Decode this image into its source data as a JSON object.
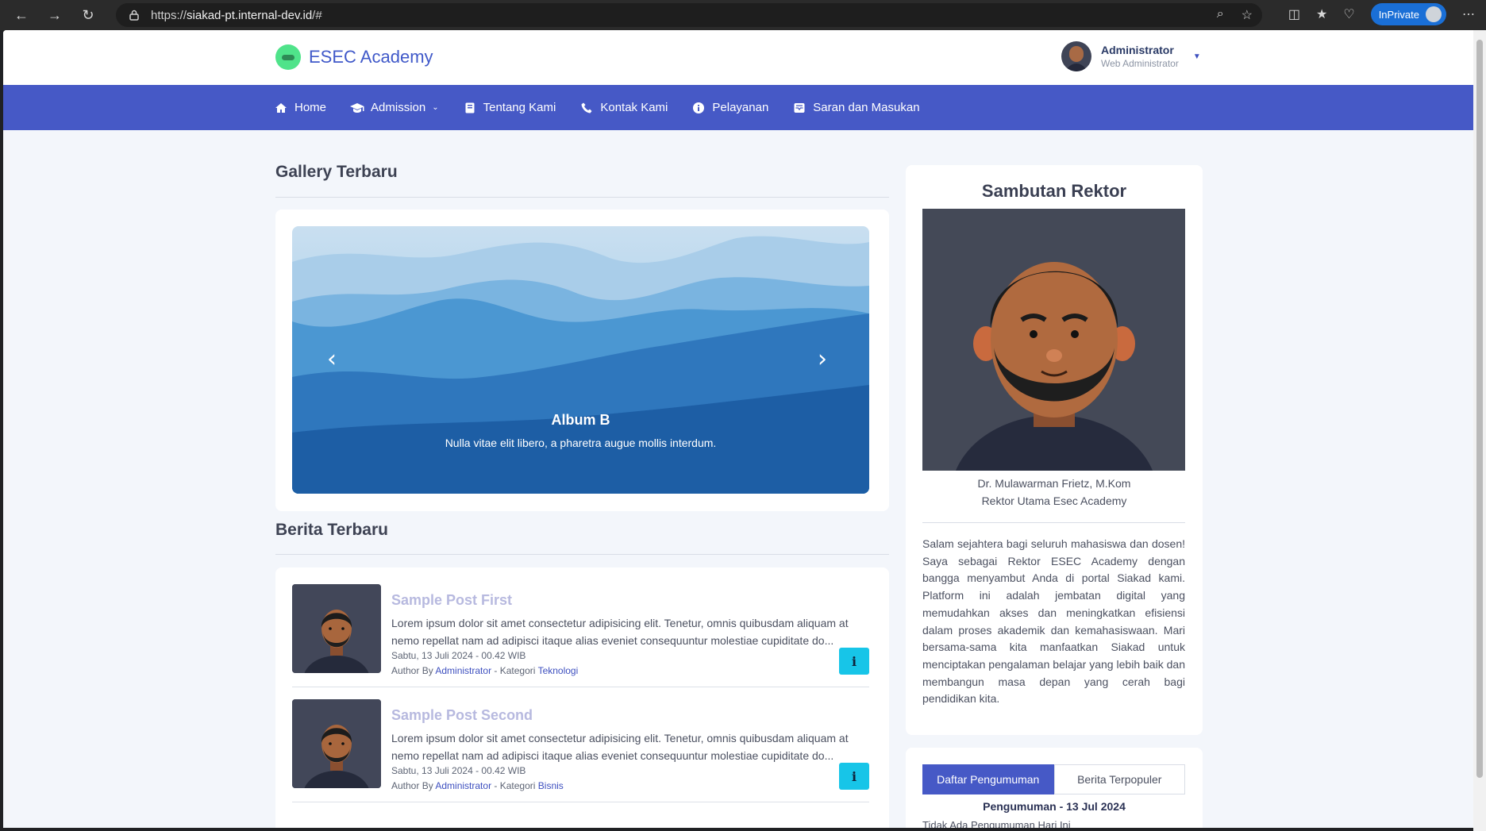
{
  "browser": {
    "url_prefix": "https://",
    "url_host": "siakad-pt.internal-dev.id",
    "url_suffix": "/#",
    "inprivate_label": "InPrivate"
  },
  "header": {
    "brand": "ESEC Academy",
    "user_name": "Administrator",
    "user_role": "Web Administrator"
  },
  "nav": {
    "items": [
      {
        "label": "Home",
        "icon": "home-icon"
      },
      {
        "label": "Admission",
        "icon": "graduation-cap-icon"
      },
      {
        "label": "Tentang Kami",
        "icon": "book-icon"
      },
      {
        "label": "Kontak Kami",
        "icon": "phone-icon"
      },
      {
        "label": "Pelayanan",
        "icon": "info-circle-icon"
      },
      {
        "label": "Saran dan Masukan",
        "icon": "inbox-icon"
      }
    ]
  },
  "gallery": {
    "title": "Gallery Terbaru",
    "slide_title": "Album B",
    "slide_text": "Nulla vitae elit libero, a pharetra augue mollis interdum."
  },
  "news": {
    "title": "Berita Terbaru",
    "posts": [
      {
        "title": "Sample Post First",
        "body": "Lorem ipsum dolor sit amet consectetur adipisicing elit. Tenetur, omnis quibusdam aliquam at nemo repellat nam ad adipisci itaque alias eveniet consequuntur molestiae cupiditate do...",
        "date": "Sabtu, 13 Juli 2024 - 00.42 WIB",
        "author_prefix": "Author By",
        "author": "Administrator",
        "category_prefix": "- Kategori",
        "category": "Teknologi",
        "info_label": "i"
      },
      {
        "title": "Sample Post Second",
        "body": "Lorem ipsum dolor sit amet consectetur adipisicing elit. Tenetur, omnis quibusdam aliquam at nemo repellat nam ad adipisci itaque alias eveniet consequuntur molestiae cupiditate do...",
        "date": "Sabtu, 13 Juli 2024 - 00.42 WIB",
        "author_prefix": "Author By",
        "author": "Administrator",
        "category_prefix": "- Kategori",
        "category": "Bisnis",
        "info_label": "i"
      }
    ]
  },
  "rector": {
    "title": "Sambutan Rektor",
    "name": "Dr. Mulawarman Frietz, M.Kom",
    "role": "Rektor Utama Esec Academy",
    "message": "Salam sejahtera bagi seluruh mahasiswa dan dosen! Saya sebagai Rektor ESEC Academy dengan bangga menyambut Anda di portal Siakad kami. Platform ini adalah jembatan digital yang memudahkan akses dan meningkatkan efisiensi dalam proses akademik dan kemahasiswaan. Mari bersama-sama kita manfaatkan Siakad untuk menciptakan pengalaman belajar yang lebih baik dan membangun masa depan yang cerah bagi pendidikan kita."
  },
  "announcements": {
    "tabs": [
      "Daftar Pengumuman",
      "Berita Terpopuler"
    ],
    "heading": "Pengumuman - 13 Jul 2024",
    "empty_text": "Tidak Ada Pengumuman Hari Ini"
  },
  "colors": {
    "navbar": "#4659c6",
    "brand": "#4059c9",
    "info_button": "#17c5e8"
  }
}
